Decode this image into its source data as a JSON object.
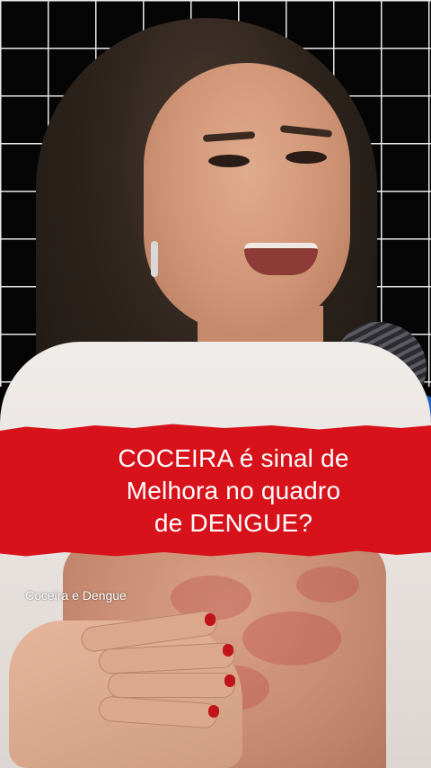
{
  "banner": {
    "lines": [
      "COCEIRA é sinal de",
      "Melhora no quadro",
      "de DENGUE?"
    ]
  },
  "caption": {
    "text": "Coceira e Dengue"
  },
  "colors": {
    "banner_red": "#d8121b",
    "grid_line": "#e8e8e8",
    "background": "#050505",
    "text": "#ffffff"
  }
}
